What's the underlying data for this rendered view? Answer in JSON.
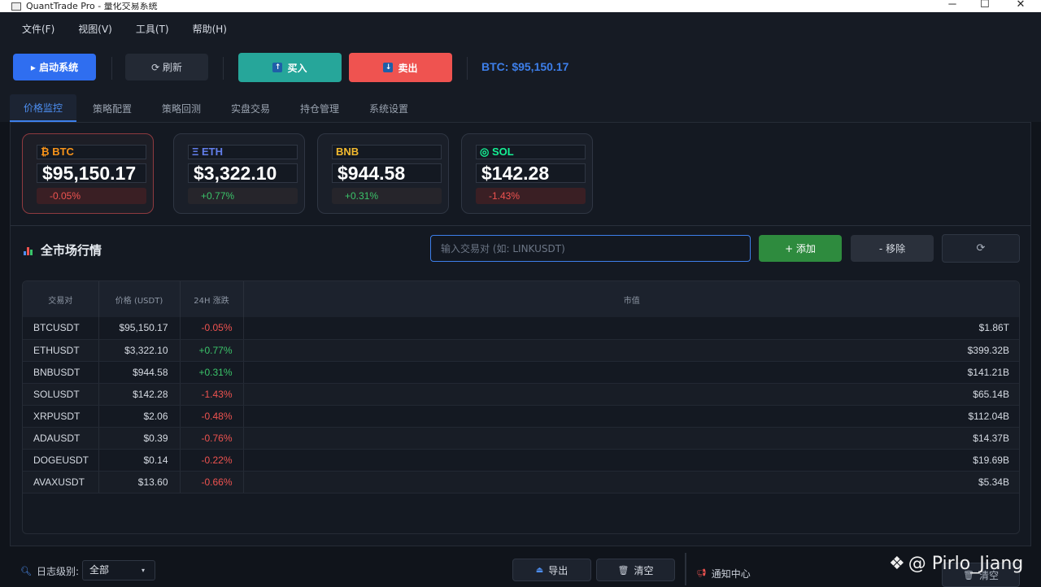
{
  "window": {
    "title": "QuantTrade Pro - 量化交易系统",
    "controls": [
      "─",
      "☐",
      "✕"
    ]
  },
  "menu": [
    "文件(F)",
    "视图(V)",
    "工具(T)",
    "帮助(H)"
  ],
  "toolbar": {
    "start_label": "▸ 启动系统",
    "refresh_label": "⟳ 刷新",
    "buy_label": "买入",
    "sell_label": "卖出",
    "btc_ticker": "BTC: $95,150.17",
    "colors": {
      "start": "#2f6ef0",
      "buy": "#26a69a",
      "sell": "#ef5350",
      "ticker": "#3d7fea"
    }
  },
  "tabs": [
    "价格监控",
    "策略配置",
    "策略回测",
    "实盘交易",
    "持仓管理",
    "系统设置"
  ],
  "cards": [
    {
      "symbol": "₿ BTC",
      "price": "$95,150.17",
      "change": "-0.05%",
      "trend": "neg",
      "color": "#f7931a"
    },
    {
      "symbol": "Ξ ETH",
      "price": "$3,322.10",
      "change": "+0.77%",
      "trend": "pos",
      "color": "#627eea"
    },
    {
      "symbol": "BNB",
      "price": "$944.58",
      "change": "+0.31%",
      "trend": "pos",
      "color": "#f3ba2f"
    },
    {
      "symbol": "◎ SOL",
      "price": "$142.28",
      "change": "-1.43%",
      "trend": "neg",
      "color": "#14f195"
    }
  ],
  "market": {
    "title": "全市场行情",
    "search_placeholder": "输入交易对 (如: LINKUSDT)",
    "add_label": "+ 添加",
    "remove_label": "- 移除",
    "refresh_icon": "⟳",
    "columns": [
      "交易对",
      "价格 (USDT)",
      "24H 涨跌",
      "市值"
    ],
    "rows": [
      {
        "pair": "BTCUSDT",
        "price": "$95,150.17",
        "change": "-0.05%",
        "trend": "neg",
        "cap": "$1.86T"
      },
      {
        "pair": "ETHUSDT",
        "price": "$3,322.10",
        "change": "+0.77%",
        "trend": "pos",
        "cap": "$399.32B"
      },
      {
        "pair": "BNBUSDT",
        "price": "$944.58",
        "change": "+0.31%",
        "trend": "pos",
        "cap": "$141.21B"
      },
      {
        "pair": "SOLUSDT",
        "price": "$142.28",
        "change": "-1.43%",
        "trend": "neg",
        "cap": "$65.14B"
      },
      {
        "pair": "XRPUSDT",
        "price": "$2.06",
        "change": "-0.48%",
        "trend": "neg",
        "cap": "$112.04B"
      },
      {
        "pair": "ADAUSDT",
        "price": "$0.39",
        "change": "-0.76%",
        "trend": "neg",
        "cap": "$14.37B"
      },
      {
        "pair": "DOGEUSDT",
        "price": "$0.14",
        "change": "-0.22%",
        "trend": "neg",
        "cap": "$19.69B"
      },
      {
        "pair": "AVAXUSDT",
        "price": "$13.60",
        "change": "-0.66%",
        "trend": "neg",
        "cap": "$5.34B"
      }
    ]
  },
  "footer": {
    "log_level_label": "日志级别:",
    "log_level_value": "全部",
    "export_label": "导出",
    "clear_label": "清空",
    "notification_label": "通知中心",
    "clear2_label": "清空"
  },
  "watermark": "@ Pirlo_Jiang"
}
